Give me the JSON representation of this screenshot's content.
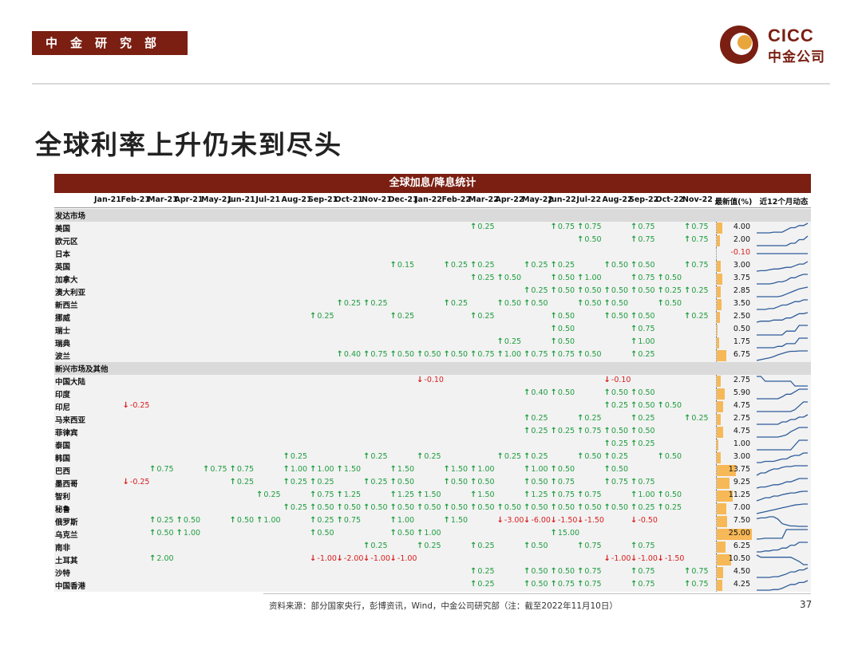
{
  "header": {
    "department": "中金研究部",
    "logo_en": "CICC",
    "logo_cn": "中金公司",
    "title": "全球利率上升仍未到尽头"
  },
  "footer": {
    "source": "资料来源：部分国家央行，彭博资讯，Wind，中金公司研究部（注：截至2022年11月10日）",
    "page": "37"
  },
  "colors": {
    "brand": "#7a1f12",
    "hike": "#1f9d3f",
    "cut": "#d81e1e",
    "bar": "#f7b857",
    "spark": "#2e5c9a"
  },
  "chart_data": {
    "type": "table",
    "title": "全球加息/降息统计",
    "months": [
      "Jan-21",
      "Feb-21",
      "Mar-21",
      "Apr-21",
      "May-21",
      "Jun-21",
      "Jul-21",
      "Aug-21",
      "Sep-21",
      "Oct-21",
      "Nov-21",
      "Dec-21",
      "Jan-22",
      "Feb-22",
      "Mar-22",
      "Apr-22",
      "May-22",
      "Jun-22",
      "Jul-22",
      "Aug-22",
      "Sep-22",
      "Oct-22",
      "Nov-22"
    ],
    "latest_header": "最新值(%)",
    "trend_header": "近12个月动态",
    "rows": [
      {
        "type": "section",
        "name": "发达市场"
      },
      {
        "name": "美国",
        "latest": "4.00",
        "changes": {
          "Mar-22": 0.25,
          "Jun-22": 0.75,
          "Jul-22": 0.75,
          "Sep-22": 0.75,
          "Nov-22": 0.75
        }
      },
      {
        "name": "欧元区",
        "latest": "2.00",
        "changes": {
          "Jul-22": 0.5,
          "Sep-22": 0.75,
          "Nov-22": 0.75
        }
      },
      {
        "name": "日本",
        "latest": "-0.10",
        "changes": {}
      },
      {
        "name": "英国",
        "latest": "3.00",
        "changes": {
          "Dec-21": 0.15,
          "Feb-22": 0.25,
          "Mar-22": 0.25,
          "May-22": 0.25,
          "Jun-22": 0.25,
          "Aug-22": 0.5,
          "Sep-22": 0.5,
          "Nov-22": 0.75
        }
      },
      {
        "name": "加拿大",
        "latest": "3.75",
        "changes": {
          "Mar-22": 0.25,
          "Apr-22": 0.5,
          "Jun-22": 0.5,
          "Jul-22": 1.0,
          "Sep-22": 0.75,
          "Oct-22": 0.5
        }
      },
      {
        "name": "澳大利亚",
        "latest": "2.85",
        "changes": {
          "May-22": 0.25,
          "Jun-22": 0.5,
          "Jul-22": 0.5,
          "Aug-22": 0.5,
          "Sep-22": 0.5,
          "Oct-22": 0.25,
          "Nov-22": 0.25
        }
      },
      {
        "name": "新西兰",
        "latest": "3.50",
        "changes": {
          "Oct-21": 0.25,
          "Nov-21": 0.25,
          "Feb-22": 0.25,
          "Apr-22": 0.5,
          "May-22": 0.5,
          "Jul-22": 0.5,
          "Aug-22": 0.5,
          "Oct-22": 0.5
        }
      },
      {
        "name": "挪威",
        "latest": "2.50",
        "changes": {
          "Sep-21": 0.25,
          "Dec-21": 0.25,
          "Mar-22": 0.25,
          "Jun-22": 0.5,
          "Aug-22": 0.5,
          "Sep-22": 0.5,
          "Nov-22": 0.25
        }
      },
      {
        "name": "瑞士",
        "latest": "0.50",
        "changes": {
          "Jun-22": 0.5,
          "Sep-22": 0.75
        }
      },
      {
        "name": "瑞典",
        "latest": "1.75",
        "changes": {
          "Apr-22": 0.25,
          "Jun-22": 0.5,
          "Sep-22": 1.0
        }
      },
      {
        "name": "波兰",
        "latest": "6.75",
        "changes": {
          "Oct-21": 0.4,
          "Nov-21": 0.75,
          "Dec-21": 0.5,
          "Jan-22": 0.5,
          "Feb-22": 0.5,
          "Mar-22": 0.75,
          "Apr-22": 1.0,
          "May-22": 0.75,
          "Jun-22": 0.75,
          "Jul-22": 0.5,
          "Sep-22": 0.25
        }
      },
      {
        "type": "section",
        "name": "新兴市场及其他"
      },
      {
        "name": "中国大陆",
        "latest": "2.75",
        "changes": {
          "Jan-22": -0.1,
          "Aug-22": -0.1
        }
      },
      {
        "name": "印度",
        "latest": "5.90",
        "changes": {
          "May-22": 0.4,
          "Jun-22": 0.5,
          "Aug-22": 0.5,
          "Sep-22": 0.5
        }
      },
      {
        "name": "印尼",
        "latest": "4.75",
        "changes": {
          "Feb-21": -0.25,
          "Aug-22": 0.25,
          "Sep-22": 0.5,
          "Oct-22": 0.5
        }
      },
      {
        "name": "马来西亚",
        "latest": "2.75",
        "changes": {
          "May-22": 0.25,
          "Jul-22": 0.25,
          "Sep-22": 0.25,
          "Nov-22": 0.25
        }
      },
      {
        "name": "菲律宾",
        "latest": "4.75",
        "changes": {
          "May-22": 0.25,
          "Jun-22": 0.25,
          "Jul-22": 0.75,
          "Aug-22": 0.5,
          "Sep-22": 0.5
        }
      },
      {
        "name": "泰国",
        "latest": "1.00",
        "changes": {
          "Aug-22": 0.25,
          "Sep-22": 0.25
        }
      },
      {
        "name": "韩国",
        "latest": "3.00",
        "changes": {
          "Aug-21": 0.25,
          "Nov-21": 0.25,
          "Jan-22": 0.25,
          "Apr-22": 0.25,
          "May-22": 0.25,
          "Jul-22": 0.5,
          "Aug-22": 0.25,
          "Oct-22": 0.5
        }
      },
      {
        "name": "巴西",
        "latest": "13.75",
        "changes": {
          "Mar-21": 0.75,
          "May-21": 0.75,
          "Jun-21": 0.75,
          "Aug-21": 1.0,
          "Sep-21": 1.0,
          "Oct-21": 1.5,
          "Dec-21": 1.5,
          "Feb-22": 1.5,
          "Mar-22": 1.0,
          "May-22": 1.0,
          "Jun-22": 0.5,
          "Aug-22": 0.5
        }
      },
      {
        "name": "墨西哥",
        "latest": "9.25",
        "changes": {
          "Feb-21": -0.25,
          "Jun-21": 0.25,
          "Aug-21": 0.25,
          "Sep-21": 0.25,
          "Nov-21": 0.25,
          "Dec-21": 0.5,
          "Feb-22": 0.5,
          "Mar-22": 0.5,
          "May-22": 0.5,
          "Jun-22": 0.75,
          "Aug-22": 0.75,
          "Sep-22": 0.75
        }
      },
      {
        "name": "智利",
        "latest": "11.25",
        "changes": {
          "Jul-21": 0.25,
          "Sep-21": 0.75,
          "Oct-21": 1.25,
          "Dec-21": 1.25,
          "Jan-22": 1.5,
          "Mar-22": 1.5,
          "May-22": 1.25,
          "Jun-22": 0.75,
          "Jul-22": 0.75,
          "Sep-22": 1.0,
          "Oct-22": 0.5
        }
      },
      {
        "name": "秘鲁",
        "latest": "7.00",
        "changes": {
          "Aug-21": 0.25,
          "Sep-21": 0.5,
          "Oct-21": 0.5,
          "Nov-21": 0.5,
          "Dec-21": 0.5,
          "Jan-22": 0.5,
          "Feb-22": 0.5,
          "Mar-22": 0.5,
          "Apr-22": 0.5,
          "May-22": 0.5,
          "Jun-22": 0.5,
          "Jul-22": 0.5,
          "Aug-22": 0.5,
          "Sep-22": 0.25,
          "Oct-22": 0.25
        }
      },
      {
        "name": "俄罗斯",
        "latest": "7.50",
        "changes": {
          "Mar-21": 0.25,
          "Apr-21": 0.5,
          "Jun-21": 0.5,
          "Jul-21": 1.0,
          "Sep-21": 0.25,
          "Oct-21": 0.75,
          "Dec-21": 1.0,
          "Feb-22": 1.5,
          "Apr-22": -3.0,
          "May-22": -6.0,
          "Jun-22": -1.5,
          "Jul-22": -1.5,
          "Sep-22": -0.5
        }
      },
      {
        "name": "乌克兰",
        "latest": "25.00",
        "changes": {
          "Mar-21": 0.5,
          "Apr-21": 1.0,
          "Sep-21": 0.5,
          "Dec-21": 0.5,
          "Jan-22": 1.0,
          "Jun-22": 15.0
        }
      },
      {
        "name": "南非",
        "latest": "6.25",
        "changes": {
          "Nov-21": 0.25,
          "Jan-22": 0.25,
          "Mar-22": 0.25,
          "May-22": 0.5,
          "Jul-22": 0.75,
          "Sep-22": 0.75
        }
      },
      {
        "name": "土耳其",
        "latest": "10.50",
        "changes": {
          "Mar-21": 2.0,
          "Sep-21": -1.0,
          "Oct-21": -2.0,
          "Nov-21": -1.0,
          "Dec-21": -1.0,
          "Aug-22": -1.0,
          "Sep-22": -1.0,
          "Oct-22": -1.5
        }
      },
      {
        "name": "沙特",
        "latest": "4.50",
        "changes": {
          "Mar-22": 0.25,
          "May-22": 0.5,
          "Jun-22": 0.5,
          "Jul-22": 0.75,
          "Sep-22": 0.75,
          "Nov-22": 0.75
        }
      },
      {
        "name": "中国香港",
        "latest": "4.25",
        "changes": {
          "Mar-22": 0.25,
          "May-22": 0.5,
          "Jun-22": 0.75,
          "Jul-22": 0.75,
          "Sep-22": 0.75,
          "Nov-22": 0.75
        }
      }
    ]
  }
}
